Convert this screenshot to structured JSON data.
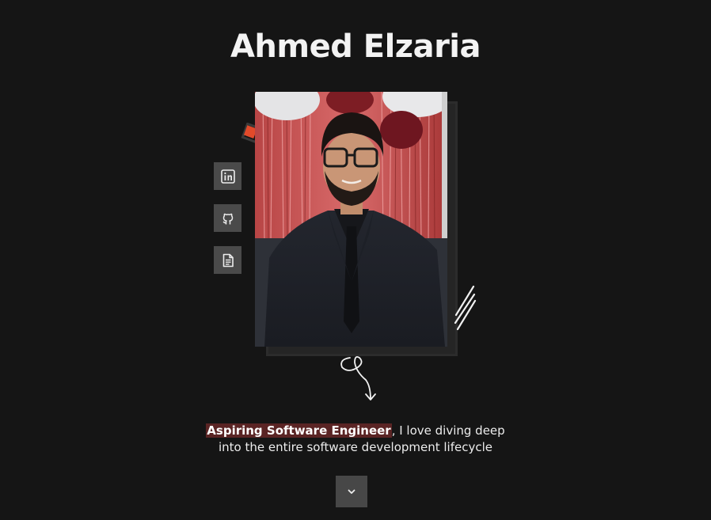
{
  "hero": {
    "name": "Ahmed Elzaria",
    "tagline_highlight": "Aspiring Software Engineer",
    "tagline_rest_line1": ", I love diving deep",
    "tagline_line2": "into the entire software development lifecycle"
  },
  "social_links": [
    {
      "icon": "linkedin-icon"
    },
    {
      "icon": "github-icon"
    },
    {
      "icon": "document-icon"
    }
  ],
  "colors": {
    "background": "#151515",
    "accent": "#e24a2a",
    "highlight": "#5a2424",
    "button": "#4a4a4a"
  }
}
